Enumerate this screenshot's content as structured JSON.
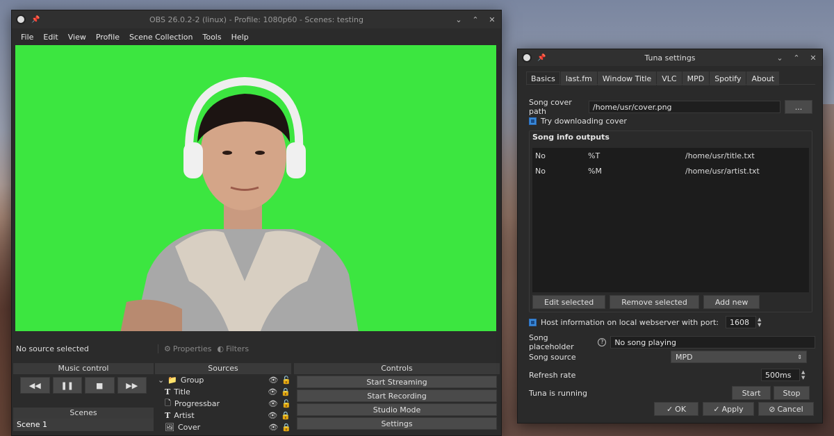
{
  "obs": {
    "title": "OBS 26.0.2-2 (linux) - Profile: 1080p60 - Scenes: testing",
    "menu": [
      "File",
      "Edit",
      "View",
      "Profile",
      "Scene Collection",
      "Tools",
      "Help"
    ],
    "status": "No source selected",
    "properties_label": "Properties",
    "filters_label": "Filters",
    "music_control_title": "Music control",
    "scenes_title": "Scenes",
    "scenes": [
      "Scene 1"
    ],
    "sources_title": "Sources",
    "sources": [
      {
        "name": "Group"
      },
      {
        "name": "Title"
      },
      {
        "name": "Progressbar"
      },
      {
        "name": "Artist"
      },
      {
        "name": "Cover"
      }
    ],
    "controls_title": "Controls",
    "controls": [
      "Start Streaming",
      "Start Recording",
      "Studio Mode",
      "Settings"
    ]
  },
  "tuna": {
    "title": "Tuna settings",
    "tabs": [
      "Basics",
      "last.fm",
      "Window Title",
      "VLC",
      "MPD",
      "Spotify",
      "About"
    ],
    "cover_path_label": "Song cover path",
    "cover_path_value": "/home/usr/cover.png",
    "browse_label": "...",
    "try_download_label": "Try downloading cover",
    "outputs_title": "Song info outputs",
    "outputs": [
      {
        "a": "No",
        "b": "%T",
        "c": "/home/usr/title.txt"
      },
      {
        "a": "No",
        "b": "%M",
        "c": "/home/usr/artist.txt"
      }
    ],
    "edit_selected": "Edit selected",
    "remove_selected": "Remove selected",
    "add_new": "Add new",
    "host_label": "Host information on local webserver with port:",
    "port_value": "1608",
    "placeholder_label": "Song placeholder",
    "placeholder_value": "No song playing",
    "source_label": "Song source",
    "source_value": "MPD",
    "refresh_label": "Refresh rate",
    "refresh_value": "500ms",
    "running_label": "Tuna is running",
    "start_label": "Start",
    "stop_label": "Stop",
    "ok_label": "OK",
    "apply_label": "Apply",
    "cancel_label": "Cancel"
  }
}
